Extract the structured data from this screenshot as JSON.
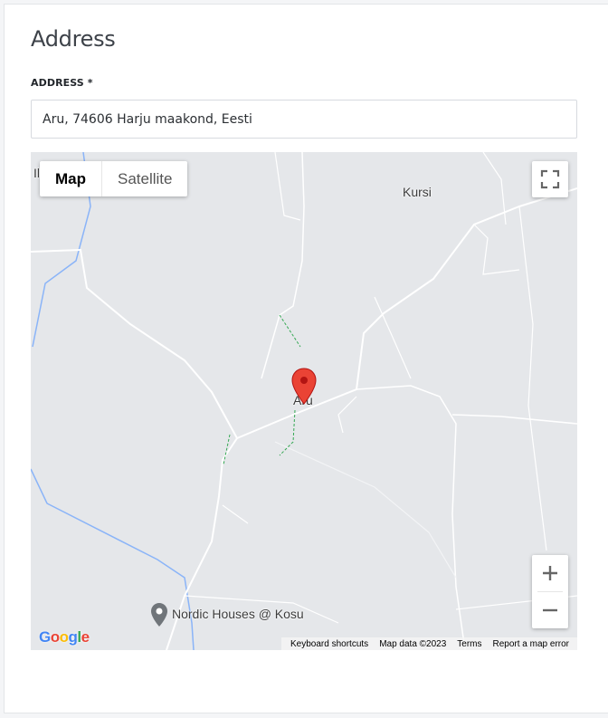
{
  "section": {
    "title": "Address"
  },
  "address_field": {
    "label": "ADDRESS *",
    "value": "Aru, 74606 Harju maakond, Eesti"
  },
  "map": {
    "type_control": {
      "map_label": "Map",
      "satellite_label": "Satellite",
      "selected": "Map"
    },
    "place_labels": {
      "village": "Kursi",
      "marker_place": "Aru",
      "business": "Nordic Houses @ Kosu",
      "edge_fragment": "Il"
    },
    "icons": {
      "fullscreen": "fullscreen-icon",
      "zoom_in": "plus-icon",
      "zoom_out": "minus-icon",
      "marker": "map-marker-icon",
      "poi": "poi-pin-icon"
    },
    "logo_text": "Google",
    "footer": {
      "keyboard_shortcuts": "Keyboard shortcuts",
      "map_data": "Map data ©2023",
      "terms": "Terms",
      "report": "Report a map error"
    },
    "colors": {
      "background": "#e5e7ea",
      "road": "#ffffff",
      "water": "#8ab4f8",
      "trail": "#34a853",
      "marker": "#ea4335"
    }
  }
}
